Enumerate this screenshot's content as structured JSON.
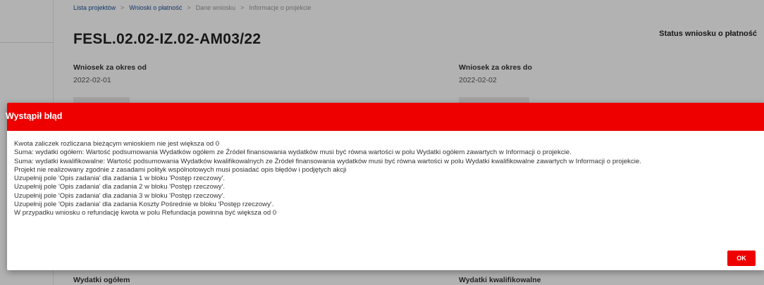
{
  "breadcrumb": [
    "Lista projektów",
    "Wnioski o płatność",
    "Dane wniosku",
    "Informacje o projekcie"
  ],
  "project": {
    "title": "FESL.02.02-IZ.02-AM03/22",
    "status_label": "Status wniosku o płatność"
  },
  "fields": {
    "period_from_label": "Wniosek za okres od",
    "period_from_value": "2022-02-01",
    "period_to_label": "Wniosek za okres do",
    "period_to_value": "2022-02-02",
    "total_expenses_label": "Wydatki ogółem",
    "eligible_expenses_label": "Wydatki kwalifikowalne"
  },
  "dialog": {
    "title": "Wystąpił błąd",
    "messages": [
      "Kwota zaliczek rozliczana bieżącym wnioskiem nie jest większa od 0",
      "Suma: wydatki ogółem: Wartość podsumowania Wydatków ogółem ze Źródeł finansowania wydatków musi być równa wartości w polu Wydatki ogółem zawartych w Informacji o projekcie.",
      "Suma: wydatki kwalifikowalne: Wartość podsumowania Wydatków kwalifikowalnych ze Źródeł finansowania wydatków musi być równa wartości w polu Wydatki kwalifikowalne zawartych w Informacji o projekcie.",
      "Projekt nie realizowany zgodnie z zasadami polityk wspólnotowych musi posiadać opis błędów i podjętych akcji",
      "Uzupełnij pole 'Opis zadania' dla zadania 1 w bloku 'Postęp rzeczowy'.",
      "Uzupełnij pole 'Opis zadania' dla zadania 2 w bloku 'Postęp rzeczowy'.",
      "Uzupełnij pole 'Opis zadania' dla zadania 3 w bloku 'Postęp rzeczowy'.",
      "Uzupełnij pole 'Opis zadania' dla zadania Koszty Pośrednie w bloku 'Postęp rzeczowy'.",
      "W przypadku wniosku o refundację kwota w polu Refundacja powinna być większa od 0"
    ],
    "ok_label": "OK"
  },
  "colors": {
    "error_red": "#ee0000",
    "link_blue": "#1a4f95"
  }
}
